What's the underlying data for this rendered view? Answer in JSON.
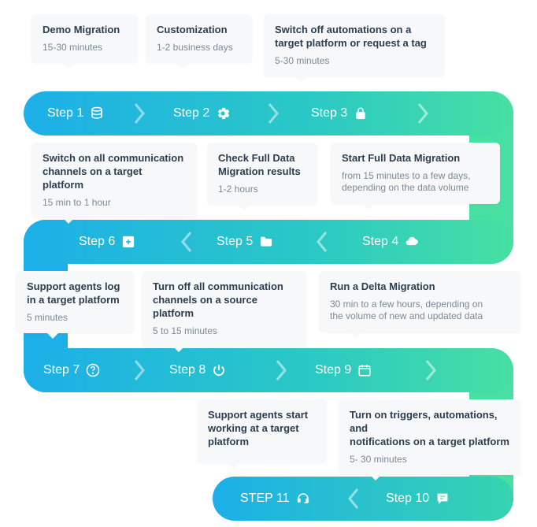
{
  "steps": [
    {
      "label": "Step 1",
      "icon": "database",
      "title": "Demo Migration",
      "desc": "15-30 minutes"
    },
    {
      "label": "Step 2",
      "icon": "gear",
      "title": "Customization",
      "desc": "1-2 business days"
    },
    {
      "label": "Step 3",
      "icon": "lock",
      "title": "Switch off automations on a\ntarget platform or request a tag",
      "desc": "5-30 minutes"
    },
    {
      "label": "Step 4",
      "icon": "cloud",
      "title": "Start Full Data Migration",
      "desc": "from 15 minutes to a few days,\ndepending on the data volume"
    },
    {
      "label": "Step 5",
      "icon": "folder",
      "title": "Check Full Data\nMigration results",
      "desc": "1-2 hours"
    },
    {
      "label": "Step 6",
      "icon": "plus",
      "title": "Switch on all communication\nchannels on a target platform",
      "desc": "15 min to 1 hour"
    },
    {
      "label": "Step 7",
      "icon": "help",
      "title": "Support agents log\nin a target platform",
      "desc": "5 minutes"
    },
    {
      "label": "Step 8",
      "icon": "power",
      "title": "Turn off all communication\nchannels on a source platform",
      "desc": "5 to 15 minutes"
    },
    {
      "label": "Step 9",
      "icon": "calendar",
      "title": "Run a Delta Migration",
      "desc": "30 min to a few hours,  depending on\nthe volume of new and updated data"
    },
    {
      "label": "Step 10",
      "icon": "chat",
      "title": "Turn on triggers, automations, and\nnotifications on a target platform",
      "desc": "5- 30 minutes"
    },
    {
      "label": "STEP 11",
      "icon": "headset",
      "title": "Support agents start\nworking at a target\nplatform",
      "desc": ""
    }
  ]
}
